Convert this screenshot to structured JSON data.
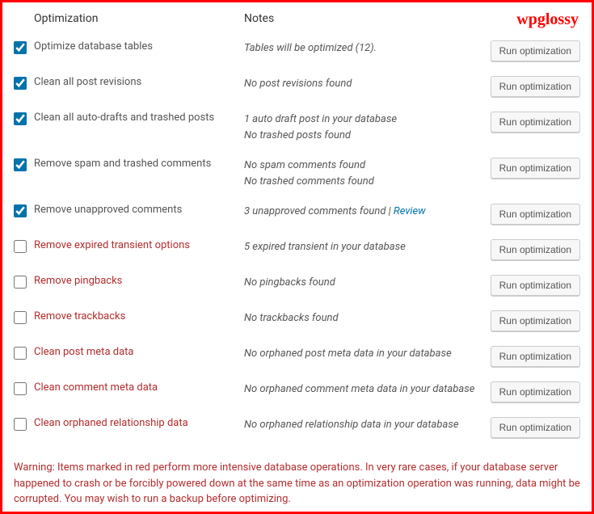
{
  "logo": "wpglossy",
  "headers": {
    "optimization": "Optimization",
    "notes": "Notes"
  },
  "button_label": "Run optimization",
  "rows": [
    {
      "checked": true,
      "danger": false,
      "label": "Optimize database tables",
      "note1": "Tables will be optimized (12).",
      "note2": ""
    },
    {
      "checked": true,
      "danger": false,
      "label": "Clean all post revisions",
      "note1": "No post revisions found",
      "note2": ""
    },
    {
      "checked": true,
      "danger": false,
      "label": "Clean all auto-drafts and trashed posts",
      "note1": "1 auto draft post in your database",
      "note2": "No trashed posts found"
    },
    {
      "checked": true,
      "danger": false,
      "label": "Remove spam and trashed comments",
      "note1": "No spam comments found",
      "note2": "No trashed comments found"
    },
    {
      "checked": true,
      "danger": false,
      "label": "Remove unapproved comments",
      "note1": "3 unapproved comments found | ",
      "note2": "",
      "link": "Review"
    },
    {
      "checked": false,
      "danger": true,
      "label": "Remove expired transient options",
      "note1": "5 expired transient in your database",
      "note2": ""
    },
    {
      "checked": false,
      "danger": true,
      "label": "Remove pingbacks",
      "note1": "No pingbacks found",
      "note2": ""
    },
    {
      "checked": false,
      "danger": true,
      "label": "Remove trackbacks",
      "note1": "No trackbacks found",
      "note2": ""
    },
    {
      "checked": false,
      "danger": true,
      "label": "Clean post meta data",
      "note1": "No orphaned post meta data in your database",
      "note2": ""
    },
    {
      "checked": false,
      "danger": true,
      "label": "Clean comment meta data",
      "note1": "No orphaned comment meta data in your database",
      "note2": ""
    },
    {
      "checked": false,
      "danger": true,
      "label": "Clean orphaned relationship data",
      "note1": "No orphaned relationship data in your database",
      "note2": ""
    }
  ],
  "warning": {
    "label": "Warning:",
    "text": " Items marked in red perform more intensive database operations. In very rare cases, if your database server happened to crash or be forcibly powered down at the same time as an optimization operation was running, data might be corrupted. You may wish to run a backup before optimizing."
  }
}
